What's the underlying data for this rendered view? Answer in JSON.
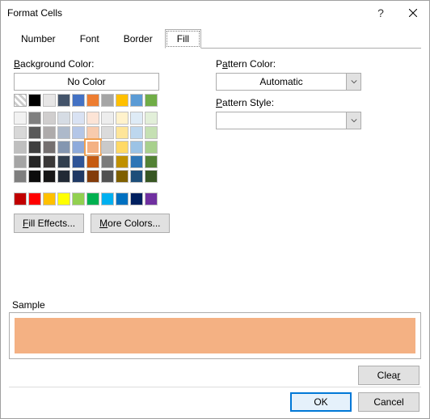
{
  "title": "Format Cells",
  "tabs": [
    "Number",
    "Font",
    "Border",
    "Fill"
  ],
  "active_tab": "Fill",
  "labels": {
    "background_color": "Background Color:",
    "no_color": "No Color",
    "pattern_color": "Pattern Color:",
    "pattern_style": "Pattern Style:",
    "sample": "Sample"
  },
  "pattern_color_value": "Automatic",
  "pattern_style_value": "",
  "buttons": {
    "fill_effects": "Fill Effects...",
    "more_colors": "More Colors...",
    "clear": "Clear",
    "ok": "OK",
    "cancel": "Cancel"
  },
  "sample_color": "#f4b183",
  "palette": {
    "row1": [
      "#ffffff",
      "#000000",
      "#e7e6e6",
      "#44546a",
      "#4472c4",
      "#ed7d31",
      "#a5a5a5",
      "#ffc000",
      "#5b9bd5",
      "#70ad47"
    ],
    "theme": [
      [
        "#f2f2f2",
        "#7f7f7f",
        "#d0cece",
        "#d6dce4",
        "#d9e2f3",
        "#fce4d6",
        "#ededed",
        "#fff2cc",
        "#deebf6",
        "#e2efd9"
      ],
      [
        "#d8d8d8",
        "#595959",
        "#aeabab",
        "#adb9ca",
        "#b4c6e7",
        "#f8cbad",
        "#dbdbdb",
        "#fee599",
        "#bdd7ee",
        "#c5e0b3"
      ],
      [
        "#bfbfbf",
        "#3f3f3f",
        "#757070",
        "#8496b0",
        "#8eaadb",
        "#f4b183",
        "#c9c9c9",
        "#ffd965",
        "#9cc3e5",
        "#a8d08d"
      ],
      [
        "#a5a5a5",
        "#262626",
        "#3a3838",
        "#323f4f",
        "#2f5496",
        "#c55a11",
        "#7b7b7b",
        "#bf9000",
        "#2e75b5",
        "#538135"
      ],
      [
        "#7f7f7f",
        "#0c0c0c",
        "#171616",
        "#222a35",
        "#1f3864",
        "#833c0b",
        "#525252",
        "#7f6000",
        "#1e4e79",
        "#375623"
      ]
    ],
    "standard": [
      "#c00000",
      "#ff0000",
      "#ffc000",
      "#ffff00",
      "#92d050",
      "#00b050",
      "#00b0f0",
      "#0070c0",
      "#002060",
      "#7030a0"
    ]
  },
  "selected_swatch": "#f4b183"
}
